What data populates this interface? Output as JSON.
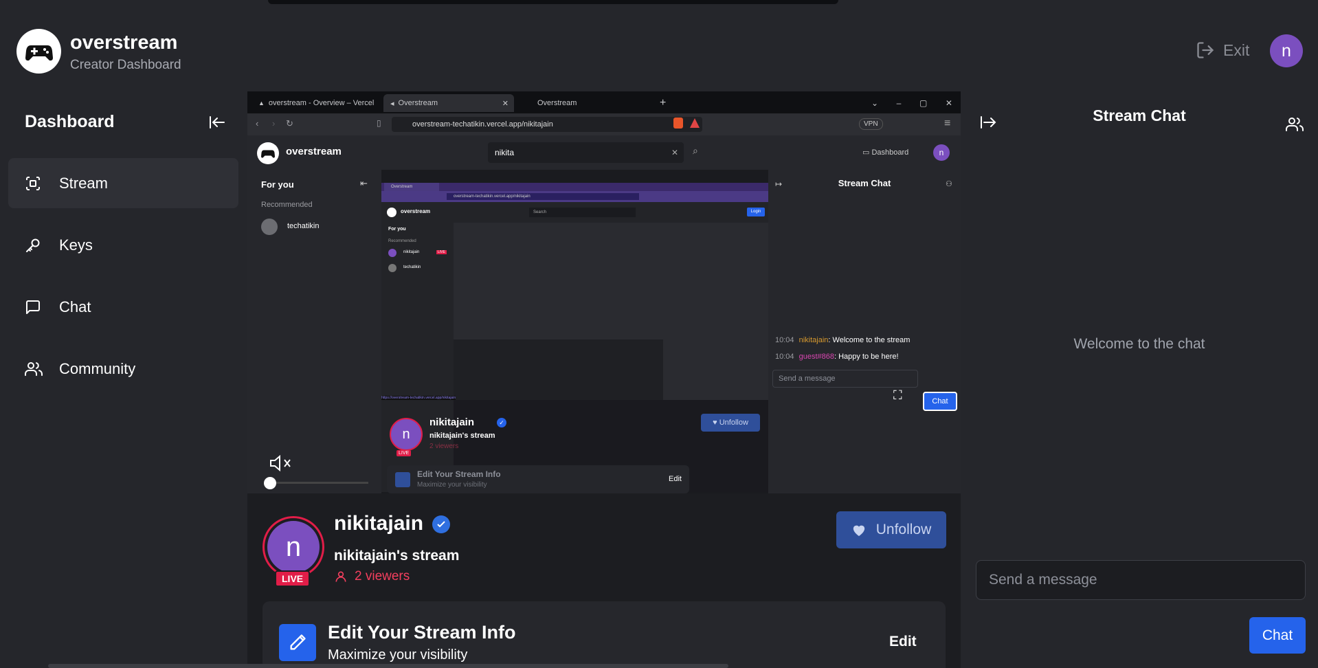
{
  "app": {
    "name": "overstream",
    "subtitle": "Creator Dashboard"
  },
  "header": {
    "exit_label": "Exit",
    "avatar_initial": "n"
  },
  "sidebar": {
    "title": "Dashboard",
    "items": [
      {
        "label": "Stream",
        "icon": "scan-icon",
        "active": true
      },
      {
        "label": "Keys",
        "icon": "key-icon",
        "active": false
      },
      {
        "label": "Chat",
        "icon": "message-square-icon",
        "active": false
      },
      {
        "label": "Community",
        "icon": "users-icon",
        "active": false
      }
    ]
  },
  "preview": {
    "tabs": [
      "overstream - Overview – Vercel",
      "Overstream",
      "Overstream"
    ],
    "url": "overstream-techatikin.vercel.app/nikitajain",
    "vpn_label": "VPN",
    "brand": "overstream",
    "search_value": "nikita",
    "dashboard_label": "Dashboard",
    "avatar_initial": "n",
    "for_you": "For you",
    "recommended": "Recommended",
    "recommended_user": "techatikin",
    "chat_title": "Stream Chat",
    "messages": [
      {
        "time": "10:04",
        "user": "nikitajain",
        "text": ": Welcome to the stream",
        "color": "#d89a2e"
      },
      {
        "time": "10:04",
        "user": "guest#868",
        "text": ": Happy to be here!",
        "color": "#d946b0"
      }
    ],
    "send_placeholder": "Send a message",
    "chat_button": "Chat",
    "mini_user": "nikitajain",
    "mini_stream": "nikitajain's stream",
    "mini_viewers": "2 viewers",
    "mini_unfollow": "Unfollow",
    "mini_live": "LIVE",
    "mini_edit_title": "Edit Your Stream Info",
    "mini_edit_sub": "Maximize your visibility",
    "mini_edit": "Edit",
    "nested": {
      "brand": "overstream",
      "search_placeholder": "Search",
      "login": "Login",
      "for_you": "For you",
      "recommended": "Recommended",
      "user1": "nikitajain",
      "user1_badge": "LIVE",
      "user2": "techatikin",
      "url_text": "overstream-techatikin.vercel.app/nikitajain",
      "tab_label": "Overstream",
      "status_url": "https://overstream-techatikin.vercel.app/nikitajain"
    }
  },
  "stream": {
    "username": "nikitajain",
    "title": "nikitajain's stream",
    "viewers": "2 viewers",
    "live": "LIVE",
    "avatar_initial": "n",
    "unfollow": "Unfollow"
  },
  "edit_card": {
    "title": "Edit Your Stream Info",
    "subtitle": "Maximize your visibility",
    "edit": "Edit"
  },
  "chat": {
    "title": "Stream Chat",
    "welcome": "Welcome to the chat",
    "placeholder": "Send a message",
    "button": "Chat"
  },
  "colors": {
    "accent": "#2563eb",
    "live": "#e11d48",
    "avatar": "#7b4fbf",
    "verified": "#2f6fe0"
  }
}
